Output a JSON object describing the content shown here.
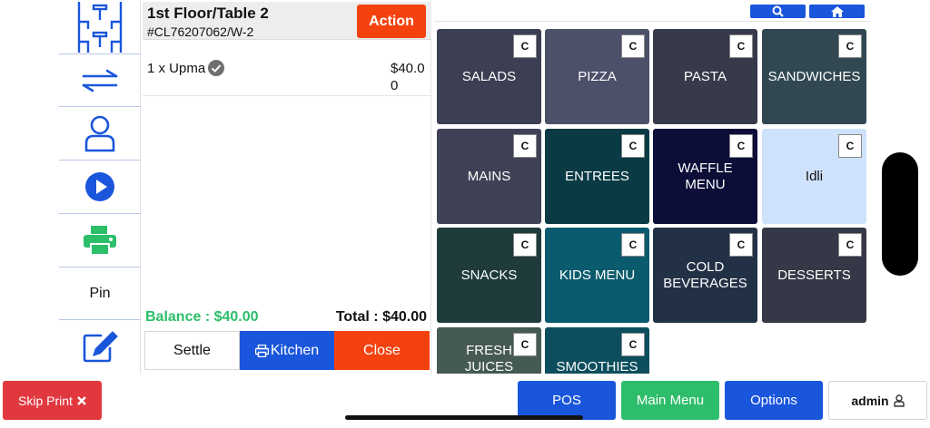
{
  "sidebar": {
    "pin_label": "Pin"
  },
  "order": {
    "table_title": "1st Floor/Table 2",
    "table_code": "#CL76207062/W-2",
    "action_label": "Action",
    "items": [
      {
        "name": "1 x Upma",
        "price": "$40.00"
      }
    ],
    "balance": "Balance : $40.00",
    "total": "Total : $40.00",
    "settle_label": "Settle",
    "kitchen_label": "Kitchen",
    "close_label": "Close"
  },
  "menu": {
    "badge": "C",
    "categories": [
      {
        "label": "SALADS",
        "color": "#3c3f53"
      },
      {
        "label": "PIZZA",
        "color": "#4c5069"
      },
      {
        "label": "PASTA",
        "color": "#363a4b"
      },
      {
        "label": "SANDWICHES",
        "color": "#314852"
      },
      {
        "label": "MAINS",
        "color": "#3f4257"
      },
      {
        "label": "ENTREES",
        "color": "#0a3a44"
      },
      {
        "label": "WAFFLE MENU",
        "color": "#0c0e38"
      },
      {
        "label": "Idli",
        "color": "#cfe2fb",
        "text_color": "#111111"
      },
      {
        "label": "SNACKS",
        "color": "#1f3b3c"
      },
      {
        "label": "KIDS MENU",
        "color": "#0b5b6e"
      },
      {
        "label": "COLD BEVERAGES",
        "color": "#233147"
      },
      {
        "label": "DESSERTS",
        "color": "#353846"
      },
      {
        "label": "FRESH JUICES",
        "color": "#465a55"
      },
      {
        "label": "SMOOTHIES",
        "color": "#0c4e5e"
      }
    ]
  },
  "bottom": {
    "skip_print_label": "Skip Print",
    "pos_label": "POS",
    "main_menu_label": "Main Menu",
    "options_label": "Options",
    "admin_label": "admin"
  },
  "colors": {
    "accent_blue": "#1a56db",
    "action_orange": "#f4420f",
    "balance_green": "#2bbf6a",
    "main_menu_green": "#2ebd6b",
    "skip_red": "#e0383e"
  }
}
